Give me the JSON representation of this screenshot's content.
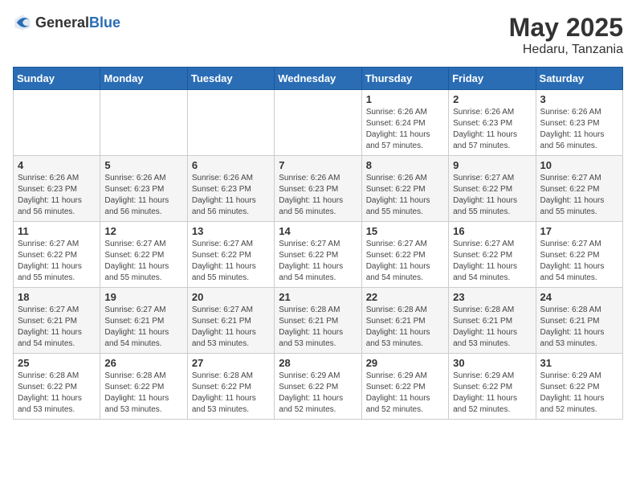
{
  "header": {
    "logo_general": "General",
    "logo_blue": "Blue",
    "month_year": "May 2025",
    "location": "Hedaru, Tanzania"
  },
  "days_of_week": [
    "Sunday",
    "Monday",
    "Tuesday",
    "Wednesday",
    "Thursday",
    "Friday",
    "Saturday"
  ],
  "weeks": [
    [
      {
        "day": "",
        "info": ""
      },
      {
        "day": "",
        "info": ""
      },
      {
        "day": "",
        "info": ""
      },
      {
        "day": "",
        "info": ""
      },
      {
        "day": "1",
        "info": "Sunrise: 6:26 AM\nSunset: 6:24 PM\nDaylight: 11 hours and 57 minutes."
      },
      {
        "day": "2",
        "info": "Sunrise: 6:26 AM\nSunset: 6:23 PM\nDaylight: 11 hours and 57 minutes."
      },
      {
        "day": "3",
        "info": "Sunrise: 6:26 AM\nSunset: 6:23 PM\nDaylight: 11 hours and 56 minutes."
      }
    ],
    [
      {
        "day": "4",
        "info": "Sunrise: 6:26 AM\nSunset: 6:23 PM\nDaylight: 11 hours and 56 minutes."
      },
      {
        "day": "5",
        "info": "Sunrise: 6:26 AM\nSunset: 6:23 PM\nDaylight: 11 hours and 56 minutes."
      },
      {
        "day": "6",
        "info": "Sunrise: 6:26 AM\nSunset: 6:23 PM\nDaylight: 11 hours and 56 minutes."
      },
      {
        "day": "7",
        "info": "Sunrise: 6:26 AM\nSunset: 6:23 PM\nDaylight: 11 hours and 56 minutes."
      },
      {
        "day": "8",
        "info": "Sunrise: 6:26 AM\nSunset: 6:22 PM\nDaylight: 11 hours and 55 minutes."
      },
      {
        "day": "9",
        "info": "Sunrise: 6:27 AM\nSunset: 6:22 PM\nDaylight: 11 hours and 55 minutes."
      },
      {
        "day": "10",
        "info": "Sunrise: 6:27 AM\nSunset: 6:22 PM\nDaylight: 11 hours and 55 minutes."
      }
    ],
    [
      {
        "day": "11",
        "info": "Sunrise: 6:27 AM\nSunset: 6:22 PM\nDaylight: 11 hours and 55 minutes."
      },
      {
        "day": "12",
        "info": "Sunrise: 6:27 AM\nSunset: 6:22 PM\nDaylight: 11 hours and 55 minutes."
      },
      {
        "day": "13",
        "info": "Sunrise: 6:27 AM\nSunset: 6:22 PM\nDaylight: 11 hours and 55 minutes."
      },
      {
        "day": "14",
        "info": "Sunrise: 6:27 AM\nSunset: 6:22 PM\nDaylight: 11 hours and 54 minutes."
      },
      {
        "day": "15",
        "info": "Sunrise: 6:27 AM\nSunset: 6:22 PM\nDaylight: 11 hours and 54 minutes."
      },
      {
        "day": "16",
        "info": "Sunrise: 6:27 AM\nSunset: 6:22 PM\nDaylight: 11 hours and 54 minutes."
      },
      {
        "day": "17",
        "info": "Sunrise: 6:27 AM\nSunset: 6:22 PM\nDaylight: 11 hours and 54 minutes."
      }
    ],
    [
      {
        "day": "18",
        "info": "Sunrise: 6:27 AM\nSunset: 6:21 PM\nDaylight: 11 hours and 54 minutes."
      },
      {
        "day": "19",
        "info": "Sunrise: 6:27 AM\nSunset: 6:21 PM\nDaylight: 11 hours and 54 minutes."
      },
      {
        "day": "20",
        "info": "Sunrise: 6:27 AM\nSunset: 6:21 PM\nDaylight: 11 hours and 53 minutes."
      },
      {
        "day": "21",
        "info": "Sunrise: 6:28 AM\nSunset: 6:21 PM\nDaylight: 11 hours and 53 minutes."
      },
      {
        "day": "22",
        "info": "Sunrise: 6:28 AM\nSunset: 6:21 PM\nDaylight: 11 hours and 53 minutes."
      },
      {
        "day": "23",
        "info": "Sunrise: 6:28 AM\nSunset: 6:21 PM\nDaylight: 11 hours and 53 minutes."
      },
      {
        "day": "24",
        "info": "Sunrise: 6:28 AM\nSunset: 6:21 PM\nDaylight: 11 hours and 53 minutes."
      }
    ],
    [
      {
        "day": "25",
        "info": "Sunrise: 6:28 AM\nSunset: 6:22 PM\nDaylight: 11 hours and 53 minutes."
      },
      {
        "day": "26",
        "info": "Sunrise: 6:28 AM\nSunset: 6:22 PM\nDaylight: 11 hours and 53 minutes."
      },
      {
        "day": "27",
        "info": "Sunrise: 6:28 AM\nSunset: 6:22 PM\nDaylight: 11 hours and 53 minutes."
      },
      {
        "day": "28",
        "info": "Sunrise: 6:29 AM\nSunset: 6:22 PM\nDaylight: 11 hours and 52 minutes."
      },
      {
        "day": "29",
        "info": "Sunrise: 6:29 AM\nSunset: 6:22 PM\nDaylight: 11 hours and 52 minutes."
      },
      {
        "day": "30",
        "info": "Sunrise: 6:29 AM\nSunset: 6:22 PM\nDaylight: 11 hours and 52 minutes."
      },
      {
        "day": "31",
        "info": "Sunrise: 6:29 AM\nSunset: 6:22 PM\nDaylight: 11 hours and 52 minutes."
      }
    ]
  ]
}
